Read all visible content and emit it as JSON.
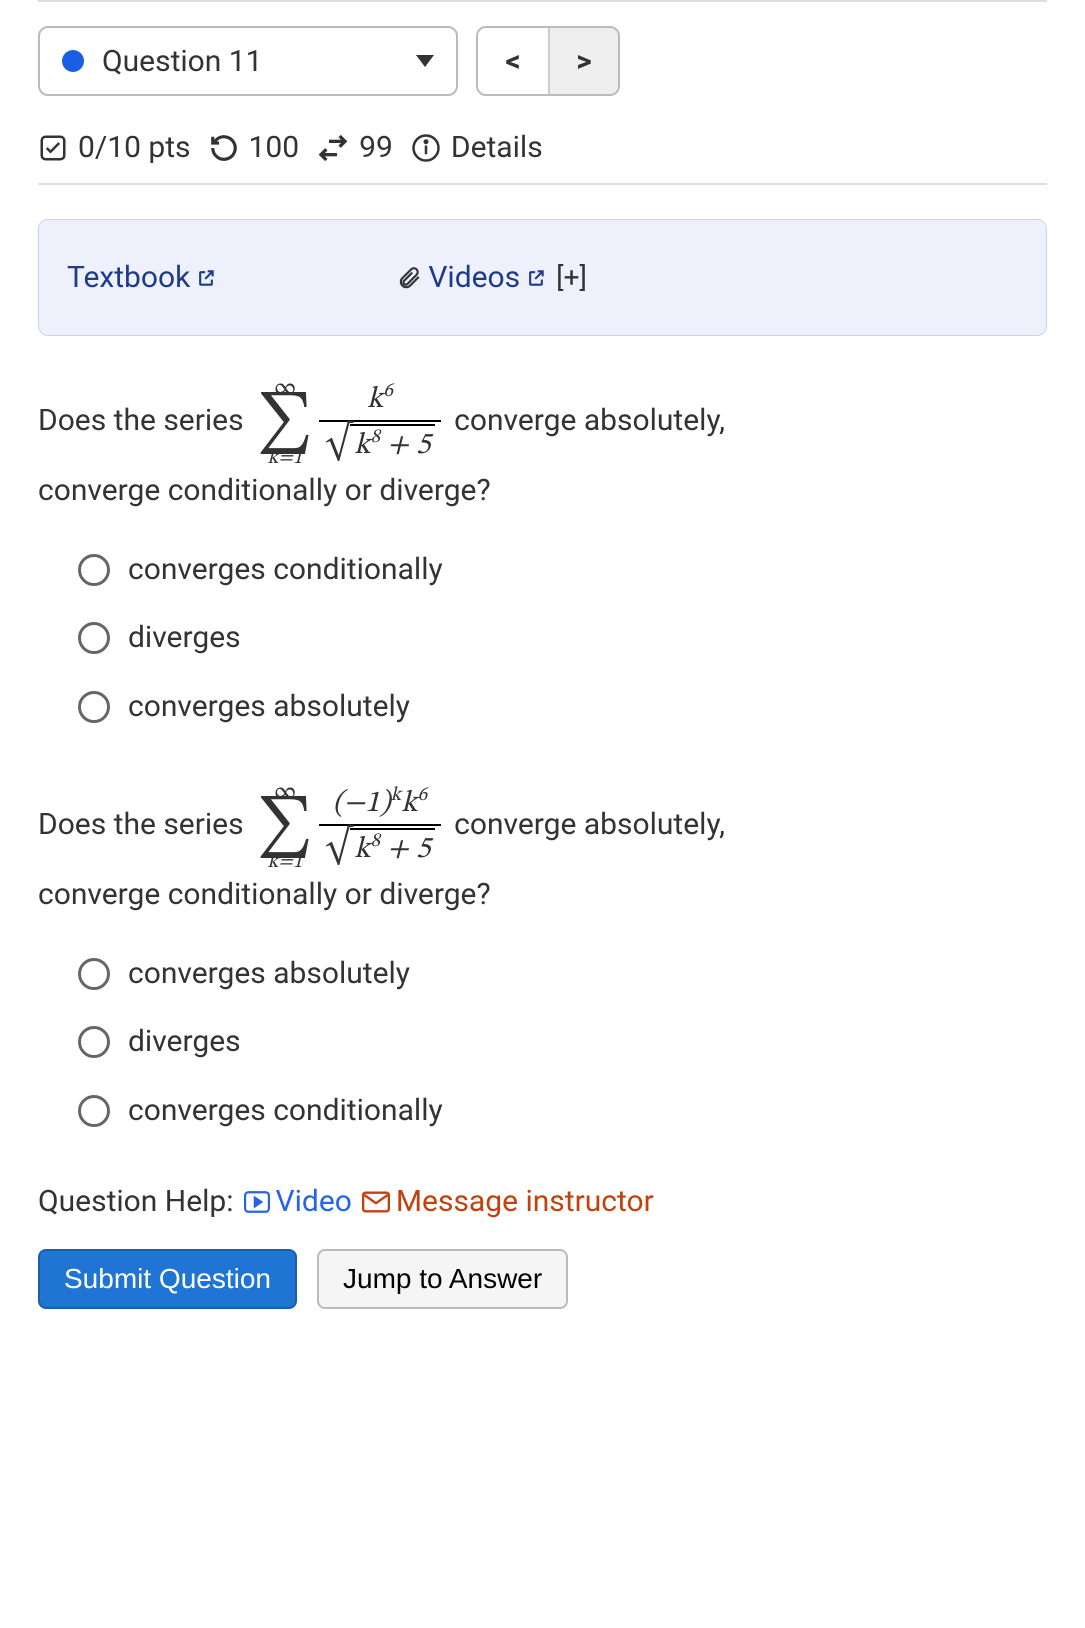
{
  "nav": {
    "question_label": "Question 11",
    "prev": "<",
    "next": ">"
  },
  "meta": {
    "score": "0/10 pts",
    "attempts_back": "100",
    "attempts_fwd": "99",
    "details": "Details"
  },
  "resources": {
    "textbook": "Textbook",
    "videos": "Videos",
    "expand": "[+]"
  },
  "q1": {
    "prefix": "Does the series",
    "suffix": "converge absolutely,",
    "line2": "converge conditionally or diverge?",
    "sigma_top": "∞",
    "sigma_bottom": "k=1",
    "numerator": "k⁶",
    "denominator_inner": "k⁸ + 5",
    "options": [
      "converges conditionally",
      "diverges",
      "converges absolutely"
    ]
  },
  "q2": {
    "prefix": "Does the series",
    "suffix": "converge absolutely,",
    "line2": "converge conditionally or diverge?",
    "sigma_top": "∞",
    "sigma_bottom": "k=1",
    "numerator": "(−1)ᵏk⁶",
    "denominator_inner": "k⁸ + 5",
    "options": [
      "converges absolutely",
      "diverges",
      "converges conditionally"
    ]
  },
  "help": {
    "label": "Question Help:",
    "video": "Video",
    "message": "Message instructor"
  },
  "buttons": {
    "submit": "Submit Question",
    "jump": "Jump to Answer"
  },
  "chart_data": {
    "type": "table",
    "note": "no chart in image"
  }
}
